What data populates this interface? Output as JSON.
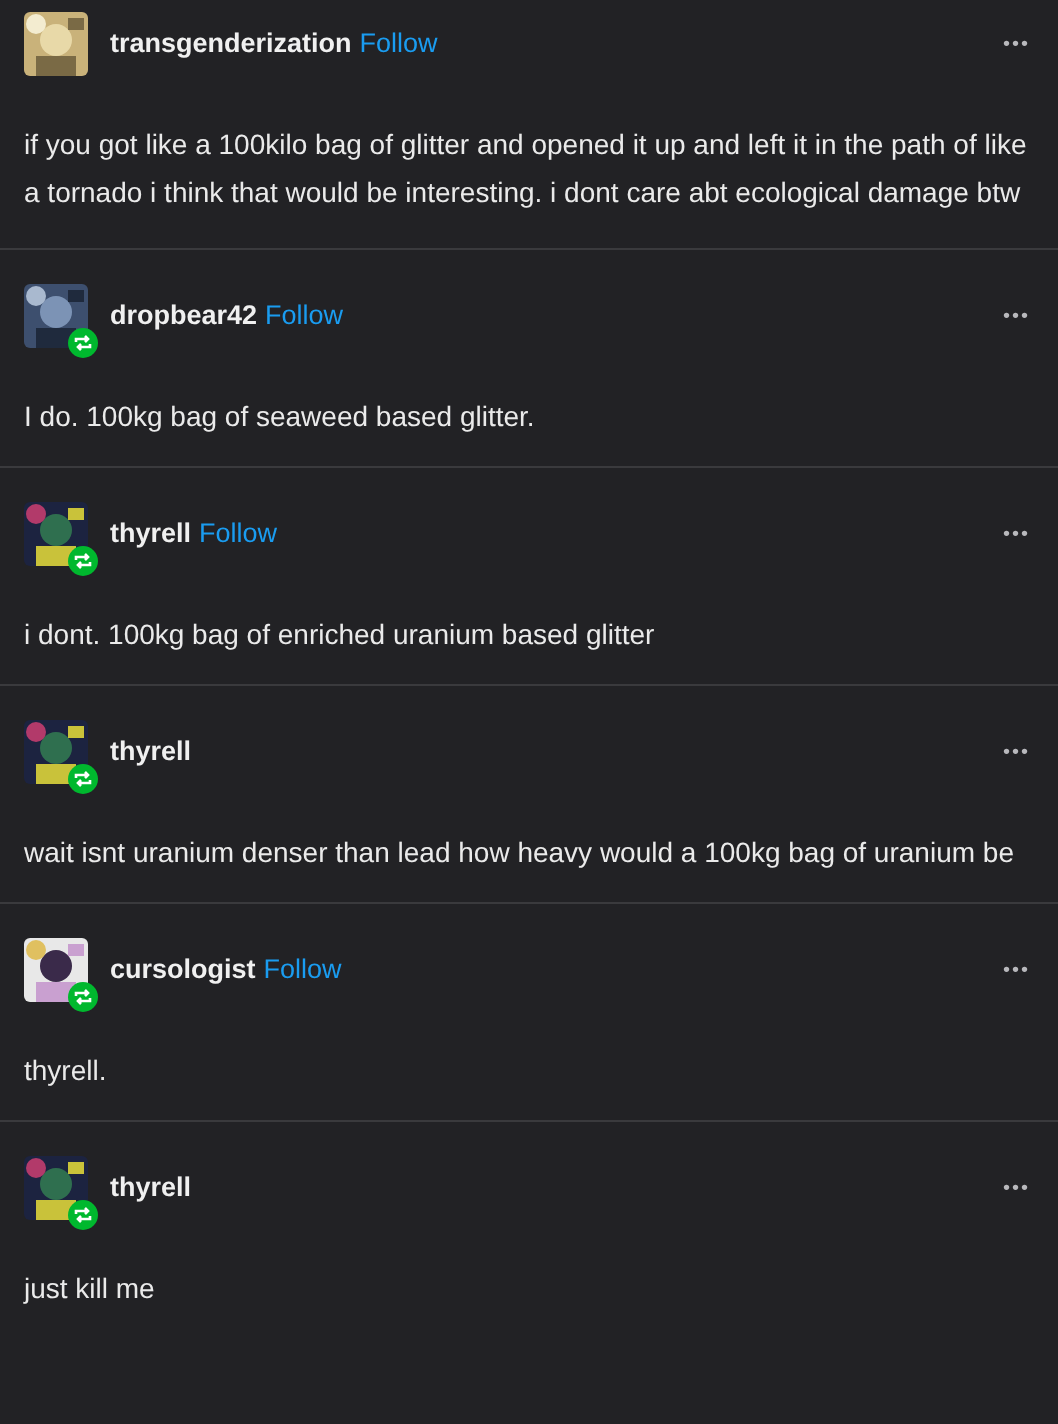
{
  "posts": [
    {
      "username": "transgenderization",
      "follow": "Follow",
      "reblogged": false,
      "menu": "•••",
      "text": "if you got like a 100kilo bag of glitter and opened it up and left it in the path of like a tornado i think that would be interesting. i dont care abt ecological damage btw"
    },
    {
      "username": "dropbear42",
      "follow": "Follow",
      "reblogged": true,
      "menu": "•••",
      "text": "I do. 100kg bag of seaweed based glitter."
    },
    {
      "username": "thyrell",
      "follow": "Follow",
      "reblogged": true,
      "menu": "•••",
      "text": "i dont. 100kg bag of enriched uranium based glitter"
    },
    {
      "username": "thyrell",
      "reblogged": true,
      "menu": "•••",
      "text": "wait isnt uranium denser than lead how heavy would a 100kg bag of uranium be"
    },
    {
      "username": "cursologist",
      "follow": "Follow",
      "reblogged": true,
      "menu": "•••",
      "text": "thyrell."
    },
    {
      "username": "thyrell",
      "reblogged": true,
      "menu": "•••",
      "text": "just kill me"
    }
  ]
}
